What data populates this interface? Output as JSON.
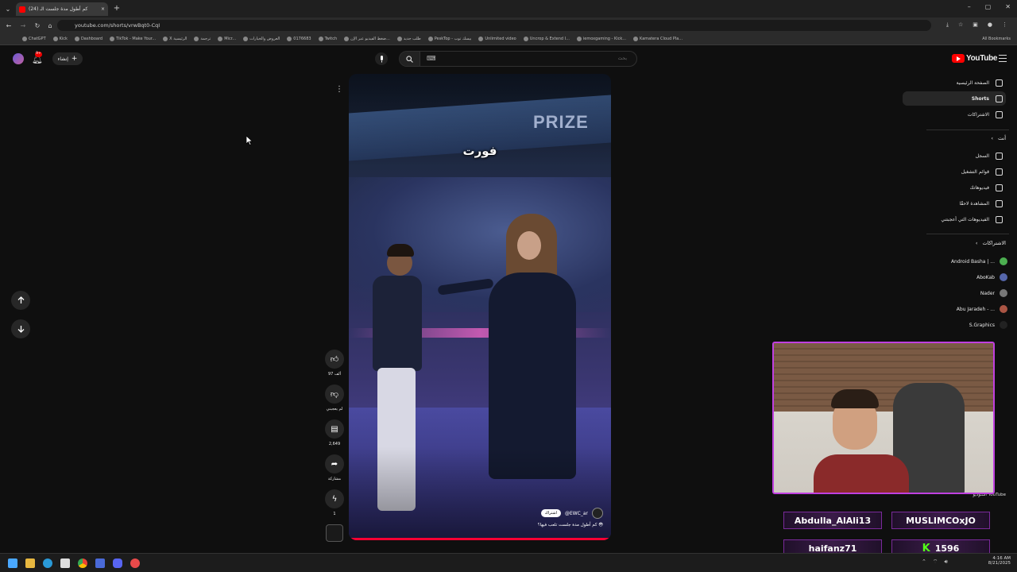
{
  "browser": {
    "tab_title": "(24) كم أطول مدة جلست الـ",
    "url": "youtube.com/shorts/vrwBqt0-CqI",
    "bookmarks": [
      "ChatGPT",
      "Kick",
      "Dashboard",
      "TikTok - Make Your...",
      "X الرئيسية",
      "ترجمة",
      "Micr...",
      "العروض والخيارات",
      "0176683",
      "Twitch",
      "ضغط الفيديو عبر الإن...",
      "طلب جديد",
      "PeskTop - بيسك توب",
      "Unlimited video",
      "Uncrop & Extend I...",
      "iemoxgaming - Kick...",
      "Kamatera Cloud Pla..."
    ],
    "all_bookmarks": "All Bookmarks"
  },
  "header": {
    "create_label": "إنشاء",
    "search_placeholder": "بحث",
    "search_kbd": "⌨",
    "logo": "YouTube"
  },
  "sidebar": {
    "main": [
      {
        "label": "الصفحة الرئيسية",
        "icon": "home-icon",
        "active": false
      },
      {
        "label": "Shorts",
        "icon": "shorts-icon",
        "active": true
      },
      {
        "label": "الاشتراكات",
        "icon": "subscriptions-icon",
        "active": false
      }
    ],
    "you_header": "أنت",
    "you": [
      {
        "label": "السجل",
        "icon": "history-icon"
      },
      {
        "label": "قوائم التشغيل",
        "icon": "playlist-icon"
      },
      {
        "label": "فيديوهاتك",
        "icon": "video-icon"
      },
      {
        "label": "المشاهدة لاحقًا",
        "icon": "clock-icon"
      },
      {
        "label": "الفيديوهات التي أعجبتني",
        "icon": "like-icon"
      }
    ],
    "subs_header": "الاشتراكات",
    "channels": [
      {
        "label": "Android Basha | ...",
        "color": "#4caf50"
      },
      {
        "label": "AboKab",
        "color": "#5566aa"
      },
      {
        "label": "Nader",
        "color": "#777777"
      },
      {
        "label": "Abu Jaradeh - ...",
        "color": "#aa5544"
      },
      {
        "label": "S.Graphics",
        "color": "#222222"
      }
    ],
    "studio_label": "استوديو YouTube"
  },
  "short": {
    "caption": "فورت",
    "channel": "@EWC_ar",
    "subscribe": "اشتراك",
    "title": "كم أطول مدة جلست تلعب فيها؟ 😳",
    "likes": "97 ألف",
    "dislike": "لم يعجبني",
    "comments": "2,649",
    "share": "مشاركة",
    "remix": "1"
  },
  "overlay": {
    "chat": [
      "Abdulla_AlAli13",
      "MUSLIMCOxJO",
      "haifanz71"
    ],
    "counter": "1596"
  },
  "taskbar": {
    "time": "4:16 AM",
    "date": "8/21/2025"
  }
}
